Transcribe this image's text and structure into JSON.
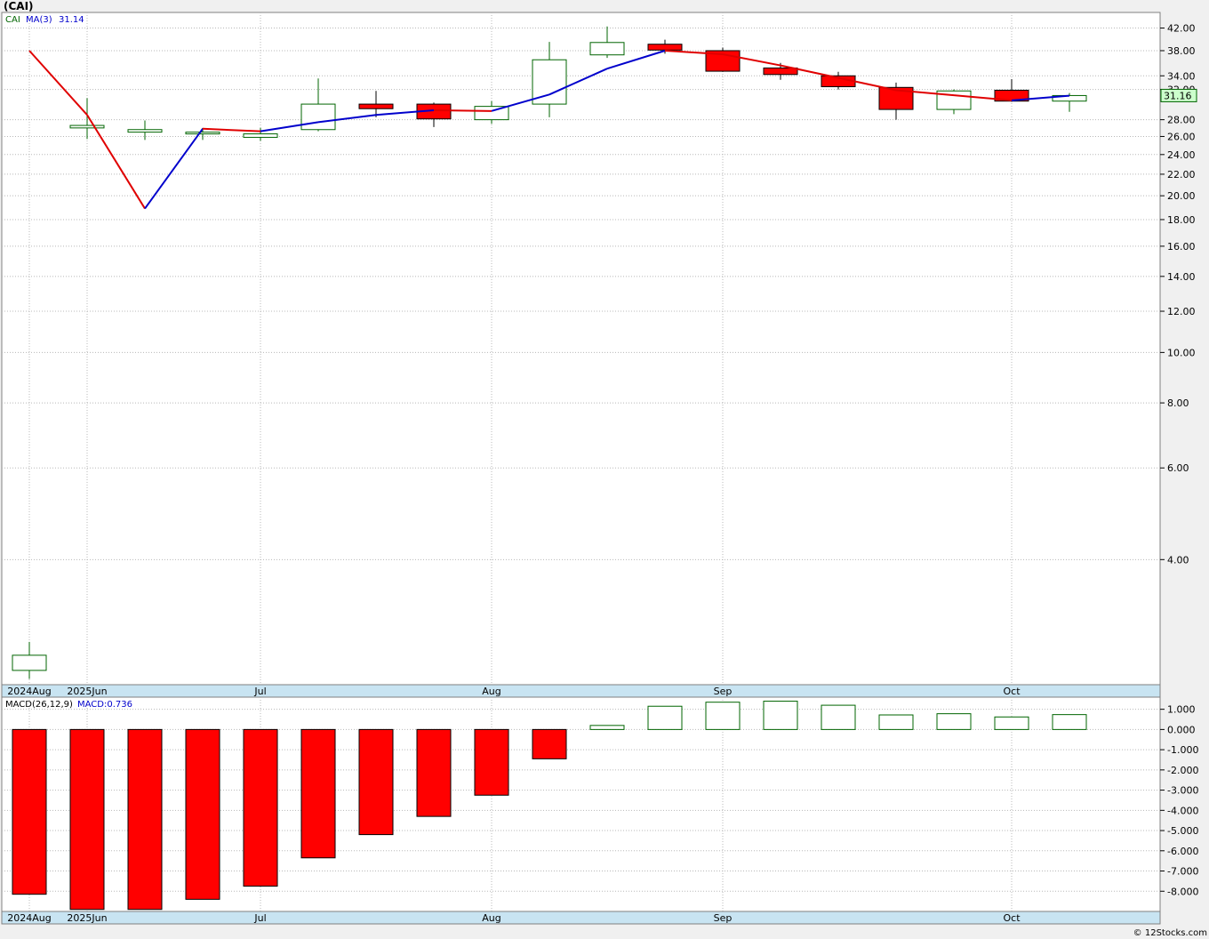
{
  "title": "(CAI)",
  "copyright": "© 12Stocks.com",
  "colors": {
    "up": "#006400",
    "down": "#ff0000",
    "ma_up": "#0000cc",
    "ma_down": "#e00000",
    "grid": "#b8b8b8",
    "axis_band": "#c8e4f2",
    "last_price_bg": "#ccffcc"
  },
  "chart_data": [
    {
      "type": "candlestick",
      "name": "price",
      "legend": {
        "symbol": "CAI",
        "ma_label": "MA(3)",
        "ma_value": "31.14"
      },
      "scale": "log",
      "ylim": [
        2.3,
        45
      ],
      "yticks": [
        4.0,
        6.0,
        8.0,
        10.0,
        12.0,
        14.0,
        16.0,
        18.0,
        20.0,
        22.0,
        24.0,
        26.0,
        28.0,
        32.0,
        34.0,
        38.0,
        42.0
      ],
      "ytick_labels": [
        "4.00",
        "6.00",
        "8.00",
        "10.00",
        "12.00",
        "14.00",
        "16.00",
        "18.00",
        "20.00",
        "22.00",
        "24.00",
        "26.00",
        "28.00",
        "32.00",
        "34.00",
        "38.00",
        "42.00"
      ],
      "last_price_label": "31.16",
      "last_price": 31.16,
      "x_labels": [
        {
          "label": "2024Aug",
          "index": 0
        },
        {
          "label": "2025Jun",
          "index": 1
        },
        {
          "label": "Jul",
          "index": 4
        },
        {
          "label": "Aug",
          "index": 8
        },
        {
          "label": "Sep",
          "index": 12
        },
        {
          "label": "Oct",
          "index": 17
        }
      ],
      "candles": [
        {
          "open": 2.45,
          "high": 2.78,
          "low": 2.36,
          "close": 2.62
        },
        {
          "open": 27.0,
          "high": 30.8,
          "low": 25.7,
          "close": 27.3
        },
        {
          "open": 26.5,
          "high": 27.9,
          "low": 25.6,
          "close": 26.8
        },
        {
          "open": 26.3,
          "high": 27.0,
          "low": 25.6,
          "close": 26.5
        },
        {
          "open": 25.9,
          "high": 27.0,
          "low": 25.5,
          "close": 26.3
        },
        {
          "open": 26.8,
          "high": 33.6,
          "low": 26.6,
          "close": 30.0
        },
        {
          "open": 30.0,
          "high": 31.8,
          "low": 28.3,
          "close": 29.4
        },
        {
          "open": 30.0,
          "high": 30.2,
          "low": 27.1,
          "close": 28.1
        },
        {
          "open": 28.0,
          "high": 30.4,
          "low": 27.5,
          "close": 29.7
        },
        {
          "open": 30.0,
          "high": 39.5,
          "low": 28.3,
          "close": 36.5
        },
        {
          "open": 37.3,
          "high": 42.3,
          "low": 36.8,
          "close": 39.4
        },
        {
          "open": 39.1,
          "high": 39.9,
          "low": 37.5,
          "close": 38.1
        },
        {
          "open": 38.0,
          "high": 38.5,
          "low": 34.6,
          "close": 34.7
        },
        {
          "open": 35.2,
          "high": 36.0,
          "low": 33.4,
          "close": 34.2
        },
        {
          "open": 34.0,
          "high": 34.6,
          "low": 32.0,
          "close": 32.4
        },
        {
          "open": 32.3,
          "high": 33.0,
          "low": 28.0,
          "close": 29.3
        },
        {
          "open": 29.3,
          "high": 32.0,
          "low": 28.7,
          "close": 31.8
        },
        {
          "open": 31.9,
          "high": 33.5,
          "low": 30.3,
          "close": 30.4
        },
        {
          "open": 30.4,
          "high": 31.5,
          "low": 29.0,
          "close": 31.16
        }
      ],
      "moving_average": [
        {
          "index": 0,
          "value": 38.0
        },
        {
          "index": 1,
          "value": 28.6
        },
        {
          "index": 2,
          "value": 18.9
        },
        {
          "index": 3,
          "value": 26.9
        },
        {
          "index": 4,
          "value": 26.6
        },
        {
          "index": 5,
          "value": 27.7
        },
        {
          "index": 6,
          "value": 28.6
        },
        {
          "index": 7,
          "value": 29.2
        },
        {
          "index": 8,
          "value": 29.1
        },
        {
          "index": 9,
          "value": 31.3
        },
        {
          "index": 10,
          "value": 35.1
        },
        {
          "index": 11,
          "value": 38.0
        },
        {
          "index": 12,
          "value": 37.4
        },
        {
          "index": 13,
          "value": 35.6
        },
        {
          "index": 14,
          "value": 33.7
        },
        {
          "index": 15,
          "value": 31.9
        },
        {
          "index": 16,
          "value": 31.2
        },
        {
          "index": 17,
          "value": 30.5
        },
        {
          "index": 18,
          "value": 31.14
        }
      ],
      "grid": true
    },
    {
      "type": "bar",
      "name": "macd",
      "legend": {
        "label": "MACD(26,12,9)",
        "value_label": "MACD:0.736"
      },
      "ylim": [
        -9.0,
        1.6
      ],
      "yticks": [
        1.0,
        0.0,
        -1.0,
        -2.0,
        -3.0,
        -4.0,
        -5.0,
        -6.0,
        -7.0,
        -8.0
      ],
      "ytick_labels": [
        "1.000",
        "0.000",
        "-1.000",
        "-2.000",
        "-3.000",
        "-4.000",
        "-5.000",
        "-6.000",
        "-7.000",
        "-8.000"
      ],
      "x_labels": [
        {
          "label": "2024Aug",
          "index": 0
        },
        {
          "label": "2025Jun",
          "index": 1
        },
        {
          "label": "Jul",
          "index": 4
        },
        {
          "label": "Aug",
          "index": 8
        },
        {
          "label": "Sep",
          "index": 12
        },
        {
          "label": "Oct",
          "index": 17
        }
      ],
      "values": [
        -8.15,
        -8.9,
        -8.9,
        -8.4,
        -7.75,
        -6.35,
        -5.2,
        -4.3,
        -3.25,
        -1.45,
        0.2,
        1.15,
        1.35,
        1.4,
        1.2,
        0.72,
        0.78,
        0.62,
        0.736
      ],
      "grid": true
    }
  ]
}
